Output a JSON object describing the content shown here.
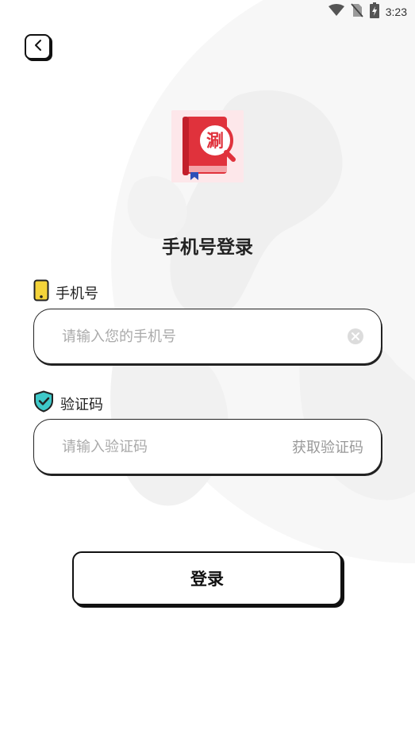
{
  "status_bar": {
    "time": "3:23",
    "icons": [
      "wifi-icon",
      "no-sim-icon",
      "battery-icon"
    ]
  },
  "header": {
    "back_icon": "chevron-left-icon"
  },
  "logo": {
    "icon": "book-magnifier-logo",
    "glyph": "涮"
  },
  "page": {
    "title": "手机号登录"
  },
  "phone_field": {
    "label": "手机号",
    "label_icon": "phone-icon",
    "placeholder": "请输入您的手机号",
    "value": "",
    "clear_icon": "clear-icon"
  },
  "code_field": {
    "label": "验证码",
    "label_icon": "shield-check-icon",
    "placeholder": "请输入验证码",
    "value": "",
    "get_code_label": "获取验证码"
  },
  "login_button": {
    "label": "登录"
  },
  "colors": {
    "accent_yellow": "#f5d43a",
    "accent_teal": "#3ec9c9",
    "logo_red": "#e0323c",
    "border": "#222222"
  }
}
